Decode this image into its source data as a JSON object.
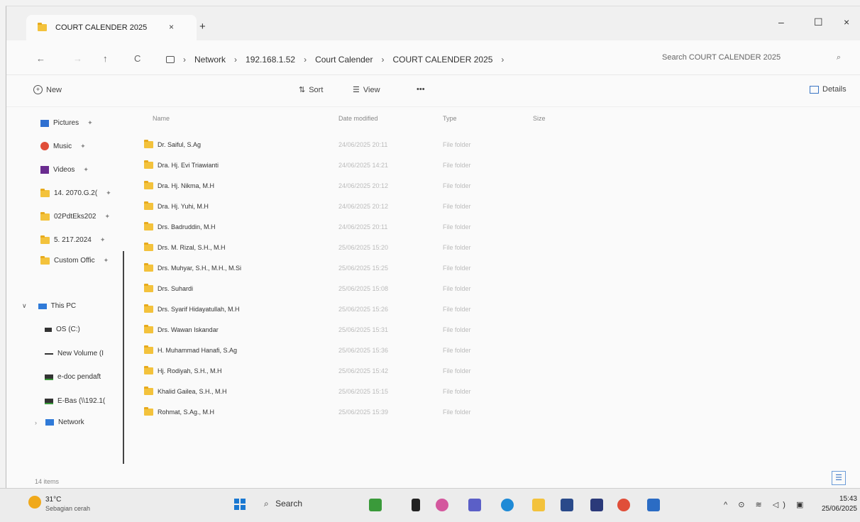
{
  "window": {
    "tab_title": "COURT CALENDER 2025",
    "tab_close": "×",
    "new_tab": "+",
    "minimize": "–",
    "maximize": "☐",
    "close": "×"
  },
  "nav": {
    "back": "←",
    "forward": "→",
    "up": "↑",
    "refresh": "C"
  },
  "breadcrumb": [
    "Network",
    "192.168.1.52",
    "Court Calender",
    "COURT CALENDER 2025"
  ],
  "search": {
    "placeholder": "Search COURT CALENDER 2025",
    "icon": "search-icon"
  },
  "toolbar": {
    "new_label": "New",
    "sort_label": "Sort",
    "view_label": "View",
    "more_label": "•••",
    "details_label": "Details"
  },
  "sidebar": {
    "quick": [
      {
        "label": "Pictures",
        "icon": "pictures-icon",
        "pin": "✦"
      },
      {
        "label": "Music",
        "icon": "music-icon",
        "pin": "✦"
      },
      {
        "label": "Videos",
        "icon": "videos-icon",
        "pin": "✦"
      },
      {
        "label": "14. 2070.G.2(",
        "icon": "folder-icon",
        "pin": "✦"
      },
      {
        "label": "02PdtEks202",
        "icon": "folder-icon",
        "pin": "✦"
      },
      {
        "label": "5. 217.2024",
        "icon": "folder-icon",
        "pin": "✦"
      },
      {
        "label": "Custom Offic",
        "icon": "folder-icon",
        "pin": "✦"
      }
    ],
    "this_pc": "This PC",
    "drives": [
      "OS (C:)",
      "New Volume (I",
      "e-doc pendaft",
      "E-Bas (\\\\192.1("
    ],
    "network": "Network"
  },
  "columns": {
    "name": "Name",
    "date": "Date modified",
    "type": "Type",
    "size": "Size"
  },
  "files": [
    {
      "name": "Dr. Saiful, S.Ag",
      "date": "24/06/2025 20:11",
      "type": "File folder"
    },
    {
      "name": "Dra. Hj. Evi Triawianti",
      "date": "24/06/2025 14:21",
      "type": "File folder"
    },
    {
      "name": "Dra. Hj. Nikma, M.H",
      "date": "24/06/2025 20:12",
      "type": "File folder"
    },
    {
      "name": "Dra. Hj. Yuhi, M.H",
      "date": "24/06/2025 20:12",
      "type": "File folder"
    },
    {
      "name": "Drs. Badruddin, M.H",
      "date": "24/06/2025 20:11",
      "type": "File folder"
    },
    {
      "name": "Drs. M. Rizal, S.H., M.H",
      "date": "25/06/2025 15:20",
      "type": "File folder"
    },
    {
      "name": "Drs. Muhyar, S.H., M.H., M.Si",
      "date": "25/06/2025 15:25",
      "type": "File folder"
    },
    {
      "name": "Drs. Suhardi",
      "date": "25/06/2025 15:08",
      "type": "File folder"
    },
    {
      "name": "Drs. Syarif Hidayatullah, M.H",
      "date": "25/06/2025 15:26",
      "type": "File folder"
    },
    {
      "name": "Drs. Wawan Iskandar",
      "date": "25/06/2025 15:31",
      "type": "File folder"
    },
    {
      "name": "H. Muhammad Hanafi, S.Ag",
      "date": "25/06/2025 15:36",
      "type": "File folder"
    },
    {
      "name": "Hj. Rodiyah, S.H., M.H",
      "date": "25/06/2025 15:42",
      "type": "File folder"
    },
    {
      "name": "Khalid Gailea, S.H., M.H",
      "date": "25/06/2025 15:15",
      "type": "File folder"
    },
    {
      "name": "Rohmat, S.Ag., M.H",
      "date": "25/06/2025 15:39",
      "type": "File folder"
    }
  ],
  "status": {
    "item_count": "14 items"
  },
  "taskbar": {
    "weather_temp": "31°C",
    "weather_desc": "Sebagian cerah",
    "search_label": "Search",
    "tray": "^ ⊙ ≋ ◁) ▣",
    "time": "15:43",
    "date": "25/06/2025"
  }
}
